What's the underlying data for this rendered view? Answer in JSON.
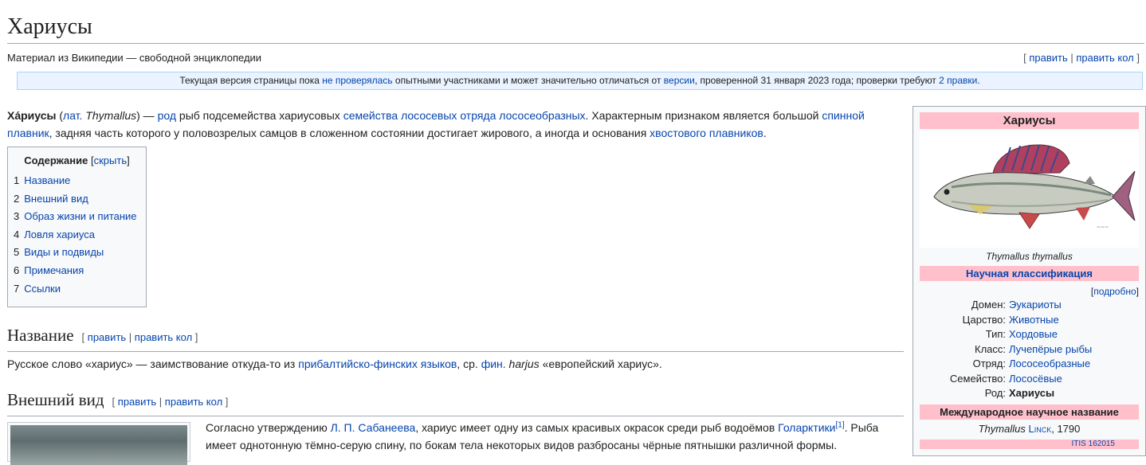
{
  "page": {
    "title": "Хариусы",
    "site_sub": "Материал из Википедии — свободной энциклопедии",
    "edit": "править",
    "edit_code": "править кол"
  },
  "notice": {
    "t1": "Текущая версия страницы пока ",
    "l1": "не проверялась",
    "t2": " опытными участниками и может значительно отличаться от ",
    "l2": "версии",
    "t3": ", проверенной 31 января 2023 года; проверки требуют ",
    "l3": "2 правки",
    "t4": "."
  },
  "lead": {
    "b1": "Ха́риусы",
    "t1": " (",
    "l1": "лат.",
    "i1": " Thymallus",
    "t2": ") — ",
    "l2": "род",
    "t3": " рыб подсемейства хариусовых ",
    "l3": "семейства лососевых",
    "t4": " ",
    "l4": "отряда лососеобразных",
    "t5": ". Характерным признаком является большой ",
    "l5": "спинной плавник",
    "t6": ", задняя часть которого у половозрелых самцов в сложенном состоянии достигает жирового, а иногда и основания ",
    "l6": "хвостового плавников",
    "t7": "."
  },
  "toc": {
    "title": "Содержание",
    "toggle": "скрыть",
    "items": [
      {
        "num": "1",
        "label": "Название"
      },
      {
        "num": "2",
        "label": "Внешний вид"
      },
      {
        "num": "3",
        "label": "Образ жизни и питание"
      },
      {
        "num": "4",
        "label": "Ловля хариуса"
      },
      {
        "num": "5",
        "label": "Виды и подвиды"
      },
      {
        "num": "6",
        "label": "Примечания"
      },
      {
        "num": "7",
        "label": "Ссылки"
      }
    ]
  },
  "sec1": {
    "title": "Название",
    "p_t1": "Русское слово «хариус» — заимствование откуда-то из ",
    "p_l1": "прибалтийско-финских языков",
    "p_t2": ", ср. ",
    "p_l2": "фин.",
    "p_i1": " harjus",
    "p_t3": " «европейский хариус»."
  },
  "sec2": {
    "title": "Внешний вид",
    "p_t1": "Согласно утверждению ",
    "p_l1": "Л. П. Сабанеева",
    "p_t2": ", хариус имеет одну из самых красивых окрасок среди рыб водоёмов ",
    "p_l2": "Голарктики",
    "p_ref": "[1]",
    "p_t3": ". Рыба имеет однотонную тёмно-серую спину, по бокам тела некоторых видов разбросаны чёрные пятнышки различной формы."
  },
  "infobox": {
    "title": "Хариусы",
    "caption": "Thymallus thymallus",
    "classification": "Научная классификация",
    "more": "подробно",
    "rows": [
      {
        "label": "Домен:",
        "value": "Эукариоты",
        "link": true
      },
      {
        "label": "Царство:",
        "value": "Животные",
        "link": true
      },
      {
        "label": "Тип:",
        "value": "Хордовые",
        "link": true
      },
      {
        "label": "Класс:",
        "value": "Лучепёрые рыбы",
        "link": true
      },
      {
        "label": "Отряд:",
        "value": "Лососеобразные",
        "link": true
      },
      {
        "label": "Семейство:",
        "value": "Лососёвые",
        "link": true
      },
      {
        "label": "Род:",
        "value": "Хариусы",
        "link": false
      }
    ],
    "intl_title": "Международное научное название",
    "intl_name": "Thymallus",
    "intl_author": "Linck",
    "intl_year": ", 1790",
    "itis": "ITIS  162015"
  }
}
